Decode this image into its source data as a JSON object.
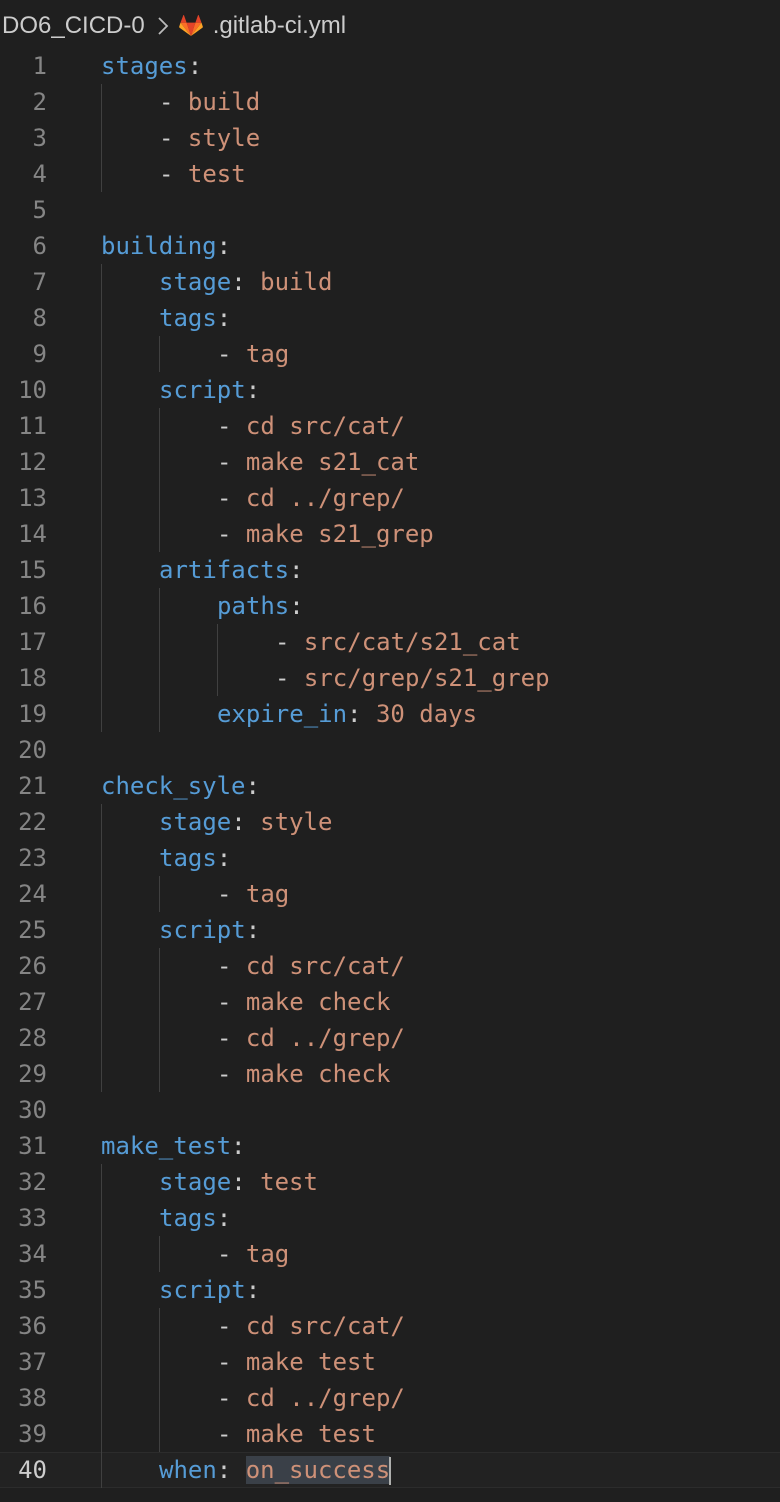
{
  "breadcrumb": {
    "folder": "DO6_CICD-0",
    "separator_icon": "chevron-right-icon",
    "file_icon": "gitlab-icon",
    "file": ".gitlab-ci.yml"
  },
  "editor": {
    "active_line": 40,
    "lines": [
      {
        "n": "1",
        "indent": 0,
        "key": "stages",
        "colon": ":",
        "dash": "",
        "value": ""
      },
      {
        "n": "2",
        "indent": 1,
        "key": "",
        "colon": "",
        "dash": "- ",
        "value": "build"
      },
      {
        "n": "3",
        "indent": 1,
        "key": "",
        "colon": "",
        "dash": "- ",
        "value": "style"
      },
      {
        "n": "4",
        "indent": 1,
        "key": "",
        "colon": "",
        "dash": "- ",
        "value": "test"
      },
      {
        "n": "5",
        "indent": 0,
        "key": "",
        "colon": "",
        "dash": "",
        "value": ""
      },
      {
        "n": "6",
        "indent": 0,
        "key": "building",
        "colon": ":",
        "dash": "",
        "value": ""
      },
      {
        "n": "7",
        "indent": 1,
        "key": "stage",
        "colon": ": ",
        "dash": "",
        "value": "build"
      },
      {
        "n": "8",
        "indent": 1,
        "key": "tags",
        "colon": ":",
        "dash": "",
        "value": ""
      },
      {
        "n": "9",
        "indent": 2,
        "key": "",
        "colon": "",
        "dash": "- ",
        "value": "tag"
      },
      {
        "n": "10",
        "indent": 1,
        "key": "script",
        "colon": ":",
        "dash": "",
        "value": ""
      },
      {
        "n": "11",
        "indent": 2,
        "key": "",
        "colon": "",
        "dash": "- ",
        "value": "cd src/cat/"
      },
      {
        "n": "12",
        "indent": 2,
        "key": "",
        "colon": "",
        "dash": "- ",
        "value": "make s21_cat"
      },
      {
        "n": "13",
        "indent": 2,
        "key": "",
        "colon": "",
        "dash": "- ",
        "value": "cd ../grep/"
      },
      {
        "n": "14",
        "indent": 2,
        "key": "",
        "colon": "",
        "dash": "- ",
        "value": "make s21_grep"
      },
      {
        "n": "15",
        "indent": 1,
        "key": "artifacts",
        "colon": ":",
        "dash": "",
        "value": ""
      },
      {
        "n": "16",
        "indent": 2,
        "key": "paths",
        "colon": ":",
        "dash": "",
        "value": ""
      },
      {
        "n": "17",
        "indent": 3,
        "key": "",
        "colon": "",
        "dash": "- ",
        "value": "src/cat/s21_cat"
      },
      {
        "n": "18",
        "indent": 3,
        "key": "",
        "colon": "",
        "dash": "- ",
        "value": "src/grep/s21_grep"
      },
      {
        "n": "19",
        "indent": 2,
        "key": "expire_in",
        "colon": ": ",
        "dash": "",
        "value": "30 days"
      },
      {
        "n": "20",
        "indent": 0,
        "key": "",
        "colon": "",
        "dash": "",
        "value": ""
      },
      {
        "n": "21",
        "indent": 0,
        "key": "check_syle",
        "colon": ":",
        "dash": "",
        "value": ""
      },
      {
        "n": "22",
        "indent": 1,
        "key": "stage",
        "colon": ": ",
        "dash": "",
        "value": "style"
      },
      {
        "n": "23",
        "indent": 1,
        "key": "tags",
        "colon": ":",
        "dash": "",
        "value": ""
      },
      {
        "n": "24",
        "indent": 2,
        "key": "",
        "colon": "",
        "dash": "- ",
        "value": "tag"
      },
      {
        "n": "25",
        "indent": 1,
        "key": "script",
        "colon": ":",
        "dash": "",
        "value": ""
      },
      {
        "n": "26",
        "indent": 2,
        "key": "",
        "colon": "",
        "dash": "- ",
        "value": "cd src/cat/"
      },
      {
        "n": "27",
        "indent": 2,
        "key": "",
        "colon": "",
        "dash": "- ",
        "value": "make check"
      },
      {
        "n": "28",
        "indent": 2,
        "key": "",
        "colon": "",
        "dash": "- ",
        "value": "cd ../grep/"
      },
      {
        "n": "29",
        "indent": 2,
        "key": "",
        "colon": "",
        "dash": "- ",
        "value": "make check"
      },
      {
        "n": "30",
        "indent": 0,
        "key": "",
        "colon": "",
        "dash": "",
        "value": ""
      },
      {
        "n": "31",
        "indent": 0,
        "key": "make_test",
        "colon": ":",
        "dash": "",
        "value": ""
      },
      {
        "n": "32",
        "indent": 1,
        "key": "stage",
        "colon": ": ",
        "dash": "",
        "value": "test"
      },
      {
        "n": "33",
        "indent": 1,
        "key": "tags",
        "colon": ":",
        "dash": "",
        "value": ""
      },
      {
        "n": "34",
        "indent": 2,
        "key": "",
        "colon": "",
        "dash": "- ",
        "value": "tag"
      },
      {
        "n": "35",
        "indent": 1,
        "key": "script",
        "colon": ":",
        "dash": "",
        "value": ""
      },
      {
        "n": "36",
        "indent": 2,
        "key": "",
        "colon": "",
        "dash": "- ",
        "value": "cd src/cat/"
      },
      {
        "n": "37",
        "indent": 2,
        "key": "",
        "colon": "",
        "dash": "- ",
        "value": "make test"
      },
      {
        "n": "38",
        "indent": 2,
        "key": "",
        "colon": "",
        "dash": "- ",
        "value": "cd ../grep/"
      },
      {
        "n": "39",
        "indent": 2,
        "key": "",
        "colon": "",
        "dash": "- ",
        "value": "make test"
      },
      {
        "n": "40",
        "indent": 1,
        "key": "when",
        "colon": ": ",
        "dash": "",
        "value": "on_success"
      }
    ]
  },
  "colors": {
    "background": "#1f1f1f",
    "key": "#569cd6",
    "value": "#ce9178",
    "punctuation": "#cccccc",
    "line_number": "#858585",
    "selection": "#3a4048"
  }
}
